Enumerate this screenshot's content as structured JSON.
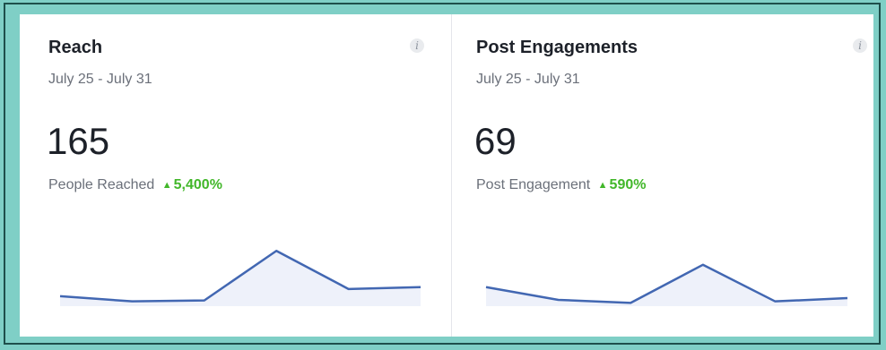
{
  "cards": [
    {
      "title": "Reach",
      "date_range": "July 25 - July 31",
      "value": "165",
      "metric_label": "People Reached",
      "trend_arrow": "▲",
      "trend_value": "5,400%",
      "info_icon": "i",
      "sparkline": [
        0.52,
        0.25,
        0.3,
        2.9,
        0.9,
        1.0
      ]
    },
    {
      "title": "Post Engagements",
      "date_range": "July 25 - July 31",
      "value": "69",
      "metric_label": "Post Engagement",
      "trend_arrow": "▲",
      "trend_value": "590%",
      "info_icon": "i",
      "sparkline": [
        1.0,
        0.33,
        0.17,
        2.17,
        0.25,
        0.42
      ]
    }
  ],
  "colors": {
    "line": "#4267b2",
    "fill": "#eef1fa",
    "trend": "#42b72a",
    "frame_bg": "#7fcfc6"
  }
}
